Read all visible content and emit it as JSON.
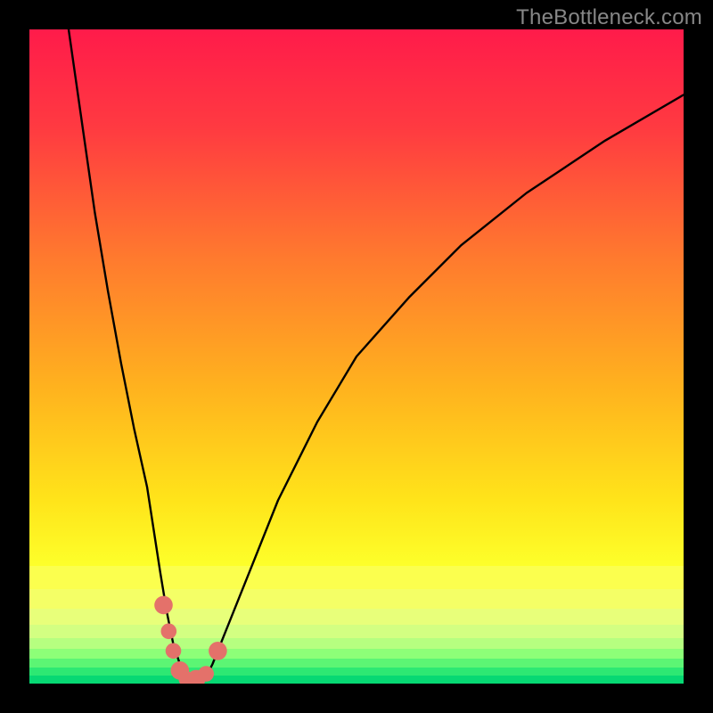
{
  "watermark": "TheBottleneck.com",
  "chart_data": {
    "type": "line",
    "title": "",
    "xlabel": "",
    "ylabel": "",
    "xlim": [
      0,
      100
    ],
    "ylim": [
      0,
      100
    ],
    "series": [
      {
        "name": "bottleneck-curve",
        "x": [
          6,
          8,
          10,
          12,
          14,
          16,
          18,
          20,
          21,
          22,
          23,
          24,
          25,
          26,
          27,
          28,
          30,
          34,
          38,
          44,
          50,
          58,
          66,
          76,
          88,
          100
        ],
        "y": [
          100,
          86,
          72,
          60,
          49,
          39,
          30,
          17,
          11,
          6,
          3,
          1,
          0.5,
          0.5,
          1,
          3,
          8,
          18,
          28,
          40,
          50,
          59,
          67,
          75,
          83,
          90
        ]
      }
    ],
    "markers": [
      {
        "name": "marker-1",
        "x": 20.5,
        "y": 12,
        "r": 1.4
      },
      {
        "name": "marker-2",
        "x": 21.3,
        "y": 8,
        "r": 1.2
      },
      {
        "name": "marker-3",
        "x": 22.0,
        "y": 5,
        "r": 1.2
      },
      {
        "name": "marker-4",
        "x": 23.0,
        "y": 2,
        "r": 1.4
      },
      {
        "name": "marker-5",
        "x": 24.0,
        "y": 0.7,
        "r": 1.2
      },
      {
        "name": "marker-6",
        "x": 25.5,
        "y": 0.7,
        "r": 1.4
      },
      {
        "name": "marker-7",
        "x": 27.0,
        "y": 1.5,
        "r": 1.2
      },
      {
        "name": "marker-8",
        "x": 28.8,
        "y": 5,
        "r": 1.4
      }
    ],
    "gradient_stops": [
      {
        "pos": 0,
        "color": "#ff1b4a"
      },
      {
        "pos": 0.15,
        "color": "#ff3a41"
      },
      {
        "pos": 0.35,
        "color": "#ff7a2e"
      },
      {
        "pos": 0.55,
        "color": "#ffb31e"
      },
      {
        "pos": 0.72,
        "color": "#ffe41a"
      },
      {
        "pos": 0.82,
        "color": "#fdff2a"
      }
    ],
    "bottom_bands": [
      {
        "color": "#fbff4e",
        "from": 0.82,
        "to": 0.855
      },
      {
        "color": "#f4ff66",
        "from": 0.855,
        "to": 0.885
      },
      {
        "color": "#e8ff7a",
        "from": 0.885,
        "to": 0.91
      },
      {
        "color": "#d3ff82",
        "from": 0.91,
        "to": 0.93
      },
      {
        "color": "#b6ff80",
        "from": 0.93,
        "to": 0.947
      },
      {
        "color": "#8dff78",
        "from": 0.947,
        "to": 0.962
      },
      {
        "color": "#5cf574",
        "from": 0.962,
        "to": 0.975
      },
      {
        "color": "#2de873",
        "from": 0.975,
        "to": 0.988
      },
      {
        "color": "#07d873",
        "from": 0.988,
        "to": 1.0
      }
    ],
    "marker_color": "#e4716a",
    "curve_color": "#000000",
    "curve_width": 2.4
  }
}
